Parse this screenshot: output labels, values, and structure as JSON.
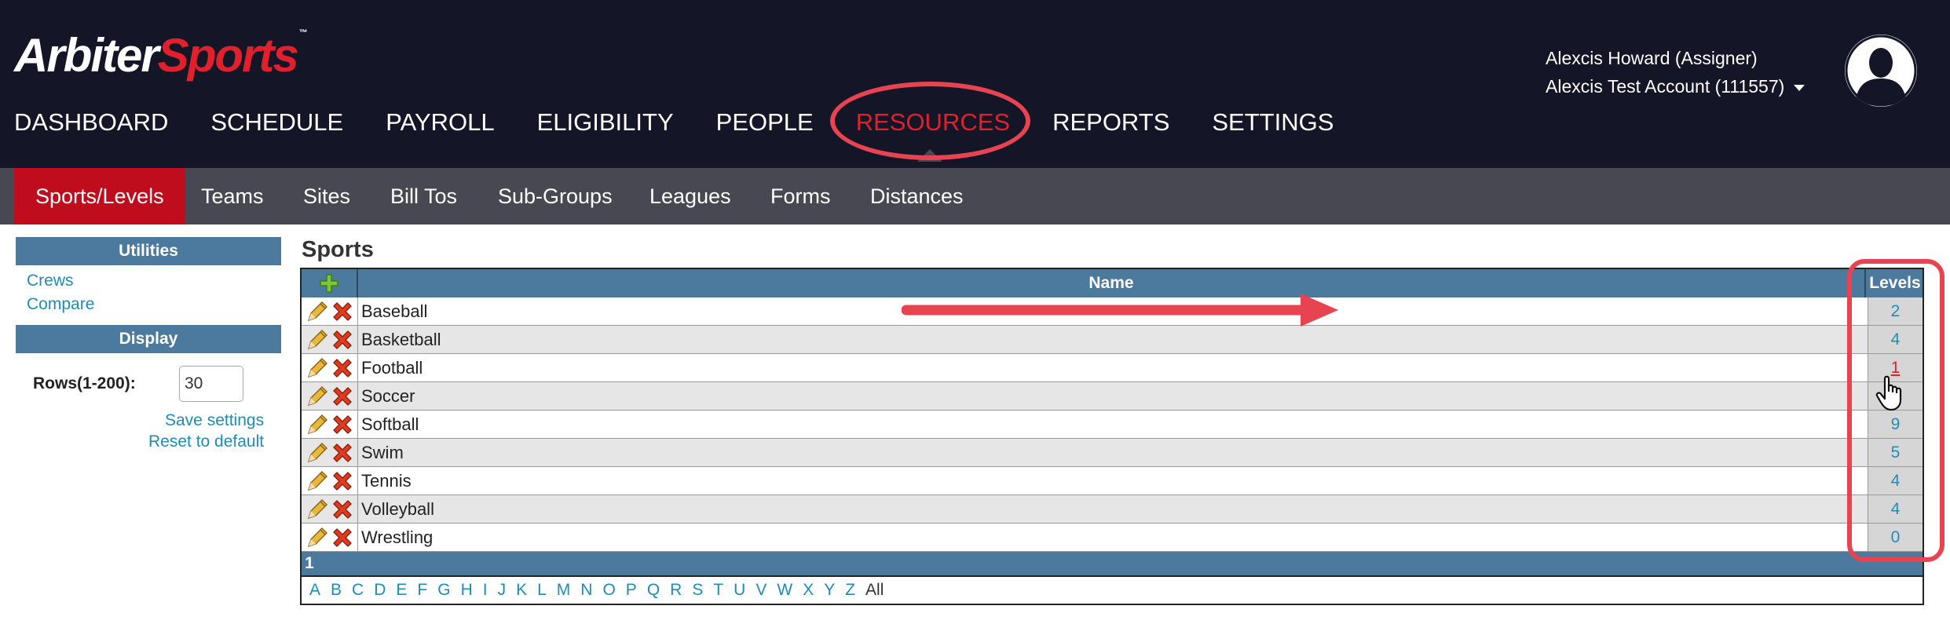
{
  "header": {
    "logo": {
      "part1": "Arbiter",
      "part2": "Sports",
      "tm": "™"
    },
    "nav": [
      {
        "label": "DASHBOARD",
        "active": false
      },
      {
        "label": "SCHEDULE",
        "active": false
      },
      {
        "label": "PAYROLL",
        "active": false
      },
      {
        "label": "ELIGIBILITY",
        "active": false
      },
      {
        "label": "PEOPLE",
        "active": false
      },
      {
        "label": "RESOURCES",
        "active": true
      },
      {
        "label": "REPORTS",
        "active": false
      },
      {
        "label": "SETTINGS",
        "active": false
      }
    ],
    "user": {
      "name": "Alexcis Howard (Assigner)",
      "account": "Alexcis Test Account (111557)"
    }
  },
  "subnav": [
    {
      "label": "Sports/Levels",
      "active": true
    },
    {
      "label": "Teams",
      "active": false
    },
    {
      "label": "Sites",
      "active": false
    },
    {
      "label": "Bill Tos",
      "active": false
    },
    {
      "label": "Sub-Groups",
      "active": false
    },
    {
      "label": "Leagues",
      "active": false
    },
    {
      "label": "Forms",
      "active": false
    },
    {
      "label": "Distances",
      "active": false
    }
  ],
  "sidebar": {
    "utilities": {
      "title": "Utilities",
      "links": [
        "Crews",
        "Compare"
      ]
    },
    "display": {
      "title": "Display",
      "rows_label": "Rows(1-200):",
      "rows_value": "30",
      "save_label": "Save settings",
      "reset_label": "Reset to default"
    }
  },
  "sports": {
    "title": "Sports",
    "columns": {
      "name": "Name",
      "levels": "Levels"
    },
    "rows": [
      {
        "name": "Baseball",
        "levels": "2"
      },
      {
        "name": "Basketball",
        "levels": "4"
      },
      {
        "name": "Football",
        "levels": "1"
      },
      {
        "name": "Soccer",
        "levels": ""
      },
      {
        "name": "Softball",
        "levels": "9"
      },
      {
        "name": "Swim",
        "levels": "5"
      },
      {
        "name": "Tennis",
        "levels": "4"
      },
      {
        "name": "Volleyball",
        "levels": "4"
      },
      {
        "name": "Wrestling",
        "levels": "0"
      }
    ],
    "page": "1",
    "alphabet": [
      "A",
      "B",
      "C",
      "D",
      "E",
      "F",
      "G",
      "H",
      "I",
      "J",
      "K",
      "L",
      "M",
      "N",
      "O",
      "P",
      "Q",
      "R",
      "S",
      "T",
      "U",
      "V",
      "W",
      "X",
      "Y",
      "Z"
    ],
    "all_label": "All"
  },
  "colors": {
    "header_bg": "#141527",
    "accent_red": "#e2202b",
    "subnav_bg": "#474852",
    "table_head": "#4c7a9e",
    "link": "#1e8db5",
    "annotation": "#e84350"
  },
  "icons": {
    "add": "plus-icon",
    "edit": "pencil-icon",
    "delete": "delete-x-icon",
    "avatar": "user-avatar-icon",
    "dropdown": "caret-down-icon",
    "cursor": "hand-pointer-icon"
  }
}
